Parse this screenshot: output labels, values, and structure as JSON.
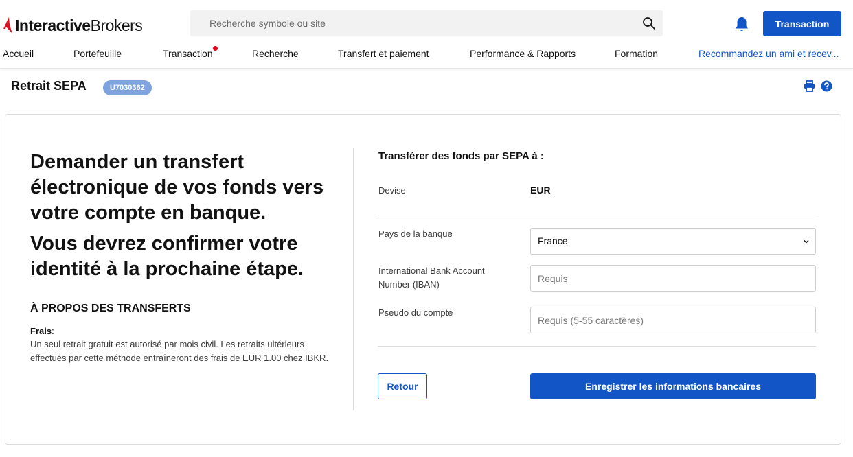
{
  "brand": {
    "name_bold": "Interactive",
    "name_light": "Brokers"
  },
  "search": {
    "placeholder": "Recherche symbole ou site"
  },
  "header": {
    "transaction_button": "Transaction"
  },
  "nav": {
    "items": [
      {
        "label": "Accueil"
      },
      {
        "label": "Portefeuille"
      },
      {
        "label": "Transaction"
      },
      {
        "label": "Recherche"
      },
      {
        "label": "Transfert et paiement"
      },
      {
        "label": "Performance & Rapports"
      },
      {
        "label": "Formation"
      },
      {
        "label": "Recommandez un ami et recev..."
      }
    ]
  },
  "page": {
    "title": "Retrait SEPA",
    "account_id": "U7030362"
  },
  "intro": {
    "headline_1": "Demander un transfert électronique de vos fonds vers votre compte en banque.",
    "headline_2": "Vous devrez confirmer votre identité à la prochaine étape.",
    "about_title": "À PROPOS DES TRANSFERTS",
    "fee_label": "Frais",
    "fee_text": "Un seul retrait gratuit est autorisé par mois civil. Les retraits ultérieurs effectués par cette méthode entraîneront des frais de EUR 1.00 chez IBKR."
  },
  "form": {
    "title": "Transférer des fonds par SEPA à :",
    "currency_label": "Devise",
    "currency_value": "EUR",
    "country_label": "Pays de la banque",
    "country_value": "France",
    "iban_label": "International Bank Account Number (IBAN)",
    "iban_placeholder": "Requis",
    "nickname_label": "Pseudo du compte",
    "nickname_placeholder": "Requis (5-55 caractères)",
    "back_button": "Retour",
    "save_button": "Enregistrer les informations bancaires"
  },
  "colors": {
    "primary": "#1155c6",
    "badge": "#7ea3de",
    "notification_dot": "#e0001b",
    "logo_red": "#d81222"
  }
}
